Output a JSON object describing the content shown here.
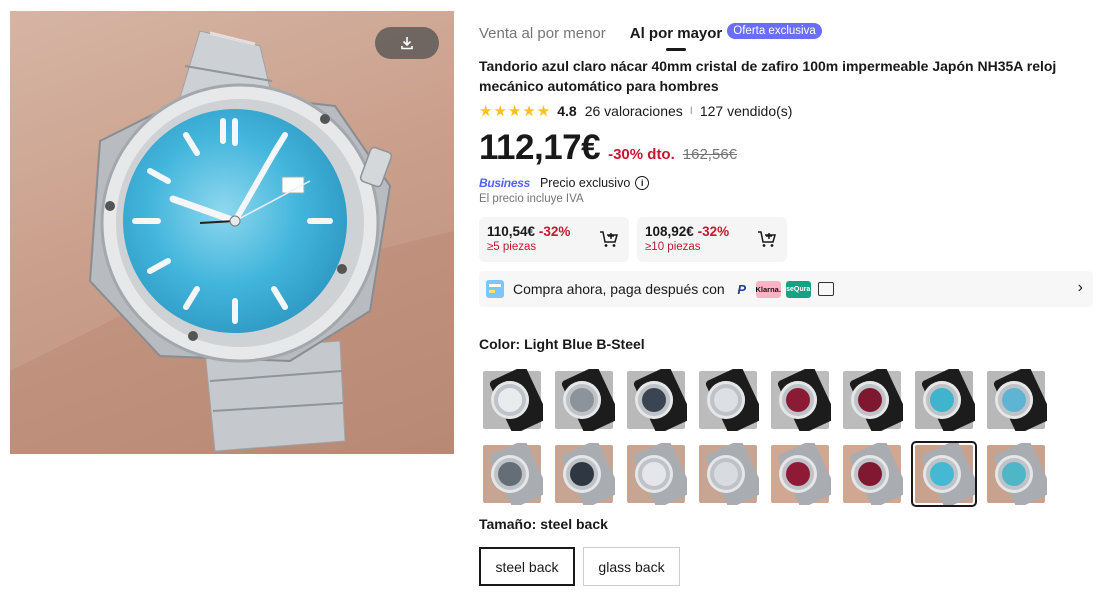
{
  "image": {
    "download_icon": "download-icon"
  },
  "tabs": {
    "retail": "Venta al por menor",
    "wholesale": "Al por mayor",
    "badge": "Oferta exclusiva"
  },
  "product": {
    "title": "Tandorio azul claro nácar 40mm cristal de zafiro 100m impermeable Japón NH35A reloj mecánico automático para hombres",
    "rating": "4.8",
    "stars": 5,
    "reviews": "26 valoraciones",
    "separator": "I",
    "sold": "127 vendido(s)",
    "price": "112,17€",
    "discount": "-30% dto.",
    "old_price": "162,56€",
    "business_logo": "Business",
    "exclusive_price": "Precio exclusivo",
    "vat": "El precio incluye IVA"
  },
  "tiers": [
    {
      "price": "110,54€",
      "pct": "-32%",
      "qty": "≥5 piezas"
    },
    {
      "price": "108,92€",
      "pct": "-32%",
      "qty": "≥10 piezas"
    }
  ],
  "bnpl": {
    "text": "Compra ahora, paga después con",
    "logos": [
      "P",
      "Klarna.",
      "seQura"
    ]
  },
  "color": {
    "label": "Color: Light Blue B-Steel",
    "selected_index": 14,
    "swatches": [
      {
        "dial": "#e9ecef",
        "strap": "#1c1c1c",
        "bg": "#b9b9b9"
      },
      {
        "dial": "#8d939a",
        "strap": "#1c1c1c",
        "bg": "#b9b9b9"
      },
      {
        "dial": "#3a4452",
        "strap": "#1c1c1c",
        "bg": "#b9b9b9"
      },
      {
        "dial": "#dcdfe3",
        "strap": "#1c1c1c",
        "bg": "#bcbcbc"
      },
      {
        "dial": "#8b1b35",
        "strap": "#1c1c1c",
        "bg": "#bcbcbc"
      },
      {
        "dial": "#7d1830",
        "strap": "#1c1c1c",
        "bg": "#bcbcbc"
      },
      {
        "dial": "#3fb4cc",
        "strap": "#1c1c1c",
        "bg": "#b6b6b6"
      },
      {
        "dial": "#5fb4d4",
        "strap": "#1c1c1c",
        "bg": "#b8b8b8"
      },
      {
        "dial": "#656d77",
        "strap": "#a9adb2",
        "bg": "#c7a592"
      },
      {
        "dial": "#2f3742",
        "strap": "#a9adb2",
        "bg": "#c7a592"
      },
      {
        "dial": "#e4e6ea",
        "strap": "#a9adb2",
        "bg": "#c7a592"
      },
      {
        "dial": "#d8dbe0",
        "strap": "#a9adb2",
        "bg": "#c7a592"
      },
      {
        "dial": "#8e1a36",
        "strap": "#a9adb2",
        "bg": "#d0a892"
      },
      {
        "dial": "#7f1830",
        "strap": "#a9adb2",
        "bg": "#d0a892"
      },
      {
        "dial": "#45b9d4",
        "strap": "#a9adb2",
        "bg": "#c9a28e"
      },
      {
        "dial": "#4fb6c8",
        "strap": "#a9adb2",
        "bg": "#c9a28e"
      }
    ]
  },
  "size": {
    "label": "Tamaño: steel back",
    "options": [
      "steel back",
      "glass back"
    ],
    "selected_index": 0
  }
}
